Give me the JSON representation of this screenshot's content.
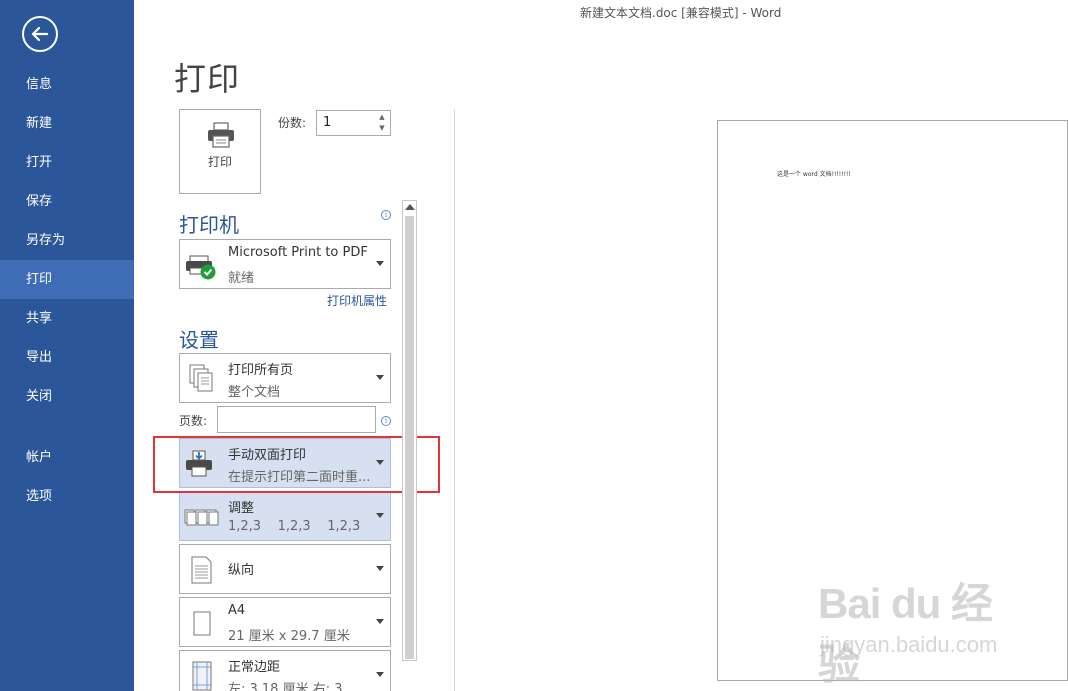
{
  "window": {
    "title": "新建文本文档.doc [兼容模式] - Word"
  },
  "sidebar": {
    "items": [
      {
        "label": "信息"
      },
      {
        "label": "新建"
      },
      {
        "label": "打开"
      },
      {
        "label": "保存"
      },
      {
        "label": "另存为"
      },
      {
        "label": "打印",
        "active": true
      },
      {
        "label": "共享"
      },
      {
        "label": "导出"
      },
      {
        "label": "关闭"
      },
      {
        "label": "帐户"
      },
      {
        "label": "选项"
      }
    ],
    "color": "#2b579a",
    "active_color": "#3e6db5"
  },
  "page": {
    "title": "打印"
  },
  "print": {
    "button_label": "打印",
    "copies_label": "份数:",
    "copies_value": "1"
  },
  "printer": {
    "heading": "打印机",
    "name": "Microsoft Print to PDF",
    "status": "就绪",
    "properties_link": "打印机属性"
  },
  "settings": {
    "heading": "设置",
    "pages_label": "页数:",
    "pages_value": "",
    "items": [
      {
        "title": "打印所有页",
        "subtitle": "整个文档",
        "icon": "pages-icon"
      },
      {
        "title": "手动双面打印",
        "subtitle": "在提示打印第二面时重...",
        "icon": "manual-duplex-icon",
        "highlighted": true
      },
      {
        "title": "调整",
        "subtitle": "1,2,3    1,2,3    1,2,3",
        "icon": "collate-icon",
        "highlighted": true
      },
      {
        "title": "纵向",
        "subtitle": "",
        "icon": "portrait-icon"
      },
      {
        "title": "A4",
        "subtitle": "21 厘米 x 29.7 厘米",
        "icon": "paper-size-icon"
      },
      {
        "title": "正常边距",
        "subtitle": "左: 3.18 厘米    右: 3...",
        "icon": "margins-icon"
      }
    ]
  },
  "preview": {
    "document_text": "这是一个 word 文档!!!!!!!!"
  },
  "watermark": {
    "main": "Bai du 经验",
    "sub": "jingyan.baidu.com"
  },
  "colors": {
    "accent": "#2b579a",
    "highlight": "#d6e0f0",
    "annotation_red": "#e23636"
  }
}
